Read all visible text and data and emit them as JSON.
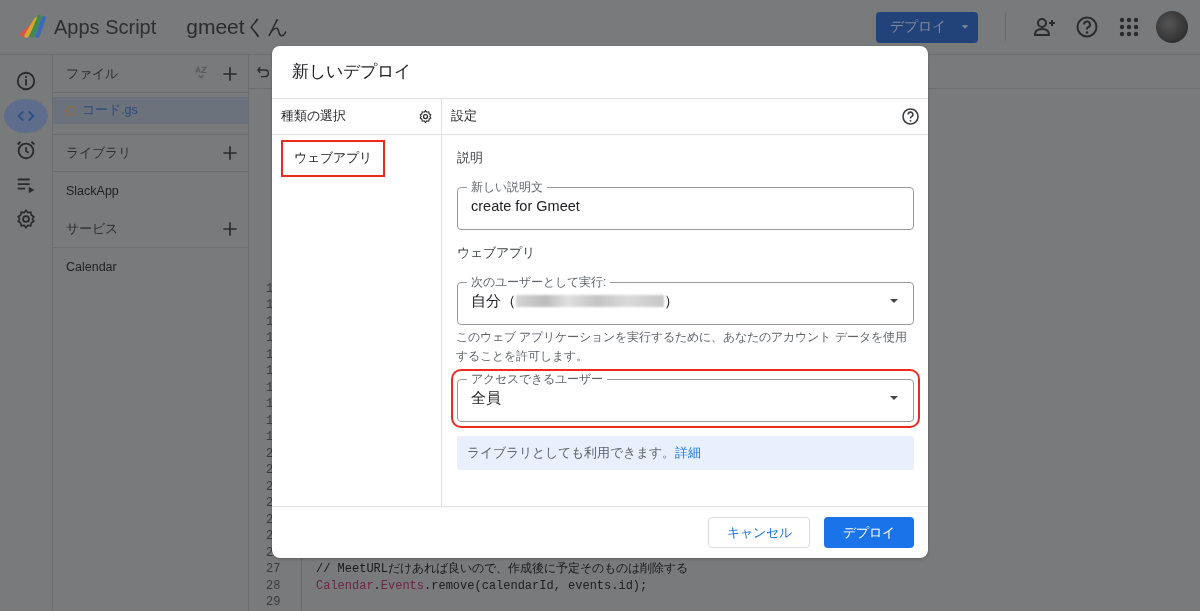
{
  "header": {
    "product": "Apps Script",
    "project": "gmeetくん",
    "deploy_button": "デプロイ"
  },
  "rail": [
    {
      "kind": "info",
      "selected": false
    },
    {
      "kind": "code",
      "selected": true
    },
    {
      "kind": "clock",
      "selected": false
    },
    {
      "kind": "executions",
      "selected": false
    },
    {
      "kind": "settings",
      "selected": false
    }
  ],
  "files": {
    "title": "ファイル",
    "items": [
      {
        "name": "コード.gs",
        "selected": true
      }
    ]
  },
  "sections": [
    {
      "title": "ライブラリ",
      "items": [
        "SlackApp"
      ]
    },
    {
      "title": "サービス",
      "items": [
        "Calendar"
      ]
    }
  ],
  "editor": {
    "gutter_partial": [
      "1",
      "1",
      "1",
      "1",
      "1",
      "1",
      "1",
      "1",
      "1",
      "1",
      "2",
      "2",
      "2",
      "2",
      "2",
      "2",
      "2"
    ],
    "lines": [
      {
        "number": "27",
        "tokens": [
          {
            "text": "// MeetURLだけあれば良いので、作成後に予定そのものは削除する",
            "kind": "comment"
          }
        ]
      },
      {
        "number": "28",
        "tokens": [
          {
            "text": "Calendar",
            "kind": "class"
          },
          {
            "text": ".",
            "kind": "plain"
          },
          {
            "text": "Events",
            "kind": "class"
          },
          {
            "text": ".remove(calendarId, events.id);",
            "kind": "plain"
          }
        ]
      },
      {
        "number": "29"
      }
    ]
  },
  "dialog": {
    "title": "新しいデプロイ",
    "type_header": "種類の選択",
    "types": [
      {
        "label": "ウェブアプリ",
        "selected": true,
        "highlighted": true
      }
    ],
    "settings_header": "設定",
    "description_heading": "説明",
    "description_field": {
      "label": "新しい説明文",
      "value": "create for Gmeet"
    },
    "webapp_heading": "ウェブアプリ",
    "fields": [
      {
        "label": "次のユーザーとして実行:",
        "value_before": "自分（",
        "redacted": true,
        "value_after": "）",
        "highlighted": false,
        "help": "このウェブ アプリケーションを実行するために、あなたのアカウント データを使用することを許可します。"
      },
      {
        "label": "アクセスできるユーザー",
        "value_before": "全員",
        "redacted": false,
        "highlighted": true
      }
    ],
    "info": {
      "text": "ライブラリとしても利用できます。",
      "link": "詳細"
    },
    "buttons": [
      {
        "label": "キャンセル",
        "kind": "secondary"
      },
      {
        "label": "デプロイ",
        "kind": "primary"
      }
    ]
  }
}
